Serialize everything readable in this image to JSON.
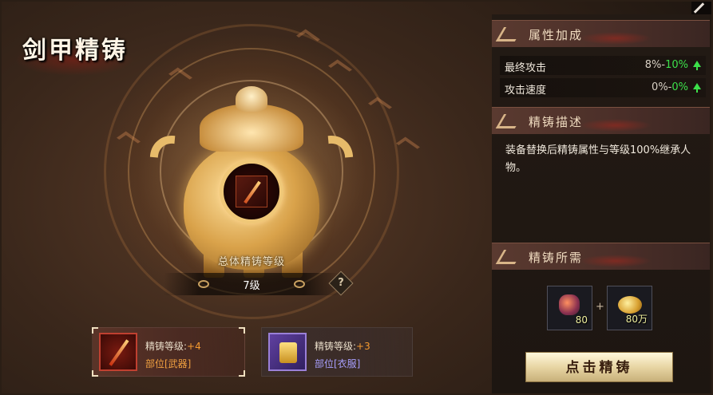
{
  "title": "剑甲精铸",
  "cauldron": {
    "level_label": "总体精铸等级",
    "level_value": "7级",
    "help_label": "?"
  },
  "slots": [
    {
      "level_label": "精铸等级:",
      "level_bonus": "+4",
      "part": "部位[武器]"
    },
    {
      "level_label": "精铸等级:",
      "level_bonus": "+3",
      "part": "部位[衣服]"
    }
  ],
  "attributes": {
    "header": "属性加成",
    "rows": [
      {
        "name": "最终攻击",
        "current": "8%-",
        "new": "10%"
      },
      {
        "name": "攻击速度",
        "current": "0%-",
        "new": "0%"
      }
    ]
  },
  "description": {
    "header": "精铸描述",
    "text": "装备替换后精铸属性与等级100%继承人物。"
  },
  "requirements": {
    "header": "精铸所需",
    "items": [
      {
        "icon": "ore-icon",
        "qty": "80"
      },
      {
        "icon": "gold-coin-icon",
        "qty": "80万"
      }
    ],
    "plus": "+"
  },
  "forge_button": "点击精铸",
  "colors": {
    "bonus_orange": "#f59a30",
    "increase_green": "#3ce04a",
    "weapon_part": "#f0a040",
    "cloth_part": "#a8a0ff"
  }
}
